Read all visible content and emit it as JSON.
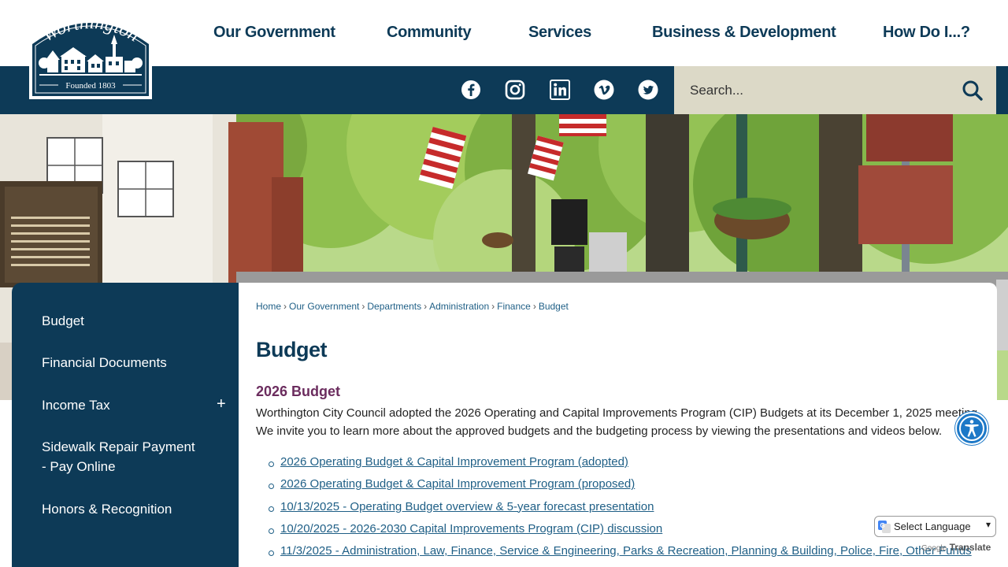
{
  "brand": {
    "logo_name": "Worthington",
    "logo_tagline": "Founded 1803",
    "colors": {
      "navy": "#0d3a57",
      "tan": "#dcd9c7",
      "plum": "#6b2c5e",
      "link": "#1f5f86"
    }
  },
  "nav": {
    "items": [
      "Our Government",
      "Community",
      "Services",
      "Business & Development",
      "How Do I...?"
    ]
  },
  "social": {
    "icons": [
      "facebook-icon",
      "instagram-icon",
      "linkedin-icon",
      "vimeo-icon",
      "twitter-icon"
    ]
  },
  "search": {
    "placeholder": "Search...",
    "icon": "search-icon"
  },
  "hero": {
    "image": "tree-lined-street-with-american-flags"
  },
  "sidebar": {
    "items": [
      {
        "label": "Budget"
      },
      {
        "label": "Financial Documents"
      },
      {
        "label": "Income Tax",
        "toggle": "+"
      },
      {
        "label_line1": "Sidewalk Repair Payment",
        "label_line2": "- Pay Online"
      },
      {
        "label": "Honors & Recognition"
      }
    ]
  },
  "breadcrumb": [
    "Home",
    "Our Government",
    "Departments",
    "Administration",
    "Finance",
    "Budget"
  ],
  "main": {
    "title": "Budget",
    "subtitle": "2026 Budget",
    "intro_line1": "Worthington City Council adopted the 2026 Operating and Capital Improvements Program (CIP) Budgets at its December 1, 2025 meeting.",
    "intro_line2": "We invite you to learn more about the approved budgets and the budgeting process by viewing the presentations and videos below.",
    "links": [
      "2026 Operating Budget & Capital Improvement Program (adopted)",
      "2026 Operating Budget & Capital Improvement Program (proposed)",
      "10/13/2025 - Operating Budget overview & 5-year forecast presentation",
      "10/20/2025 - 2026-2030 Capital Improvements Program (CIP) discussion",
      "11/3/2025 - Administration, Law, Finance, Service & Engineering, Parks & Recreation, Planning & Building, Police, Fire, Other Funds"
    ]
  },
  "translate": {
    "select_label": "Select Language",
    "google": "Google",
    "translate": "Translate"
  },
  "accessibility": {
    "icon": "accessibility-icon"
  }
}
